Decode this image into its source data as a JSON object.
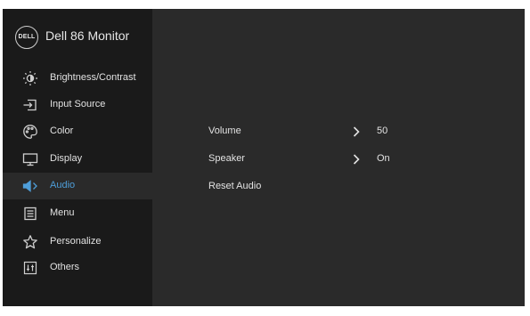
{
  "brand": {
    "logo_text": "DELL",
    "model": "Dell 86 Monitor"
  },
  "sidebar": {
    "items": [
      {
        "label": "Brightness/Contrast",
        "icon": "brightness-icon",
        "active": false
      },
      {
        "label": "Input Source",
        "icon": "input-source-icon",
        "active": false
      },
      {
        "label": "Color",
        "icon": "color-palette-icon",
        "active": false
      },
      {
        "label": "Display",
        "icon": "display-monitor-icon",
        "active": false
      },
      {
        "label": "Audio",
        "icon": "speaker-icon",
        "active": true
      },
      {
        "label": "Menu",
        "icon": "menu-list-icon",
        "active": false
      },
      {
        "label": "Personalize",
        "icon": "star-icon",
        "active": false
      },
      {
        "label": "Others",
        "icon": "others-settings-icon",
        "active": false
      }
    ]
  },
  "audio": {
    "options": [
      {
        "label": "Volume",
        "has_submenu": true,
        "value": "50"
      },
      {
        "label": "Speaker",
        "has_submenu": true,
        "value": "On"
      },
      {
        "label": "Reset Audio",
        "has_submenu": false,
        "value": ""
      }
    ]
  },
  "colors": {
    "sidebar_bg": "#1a1a1a",
    "panel_bg": "#2a2a2a",
    "text": "#e2e2e2",
    "accent": "#4e9ed9"
  }
}
